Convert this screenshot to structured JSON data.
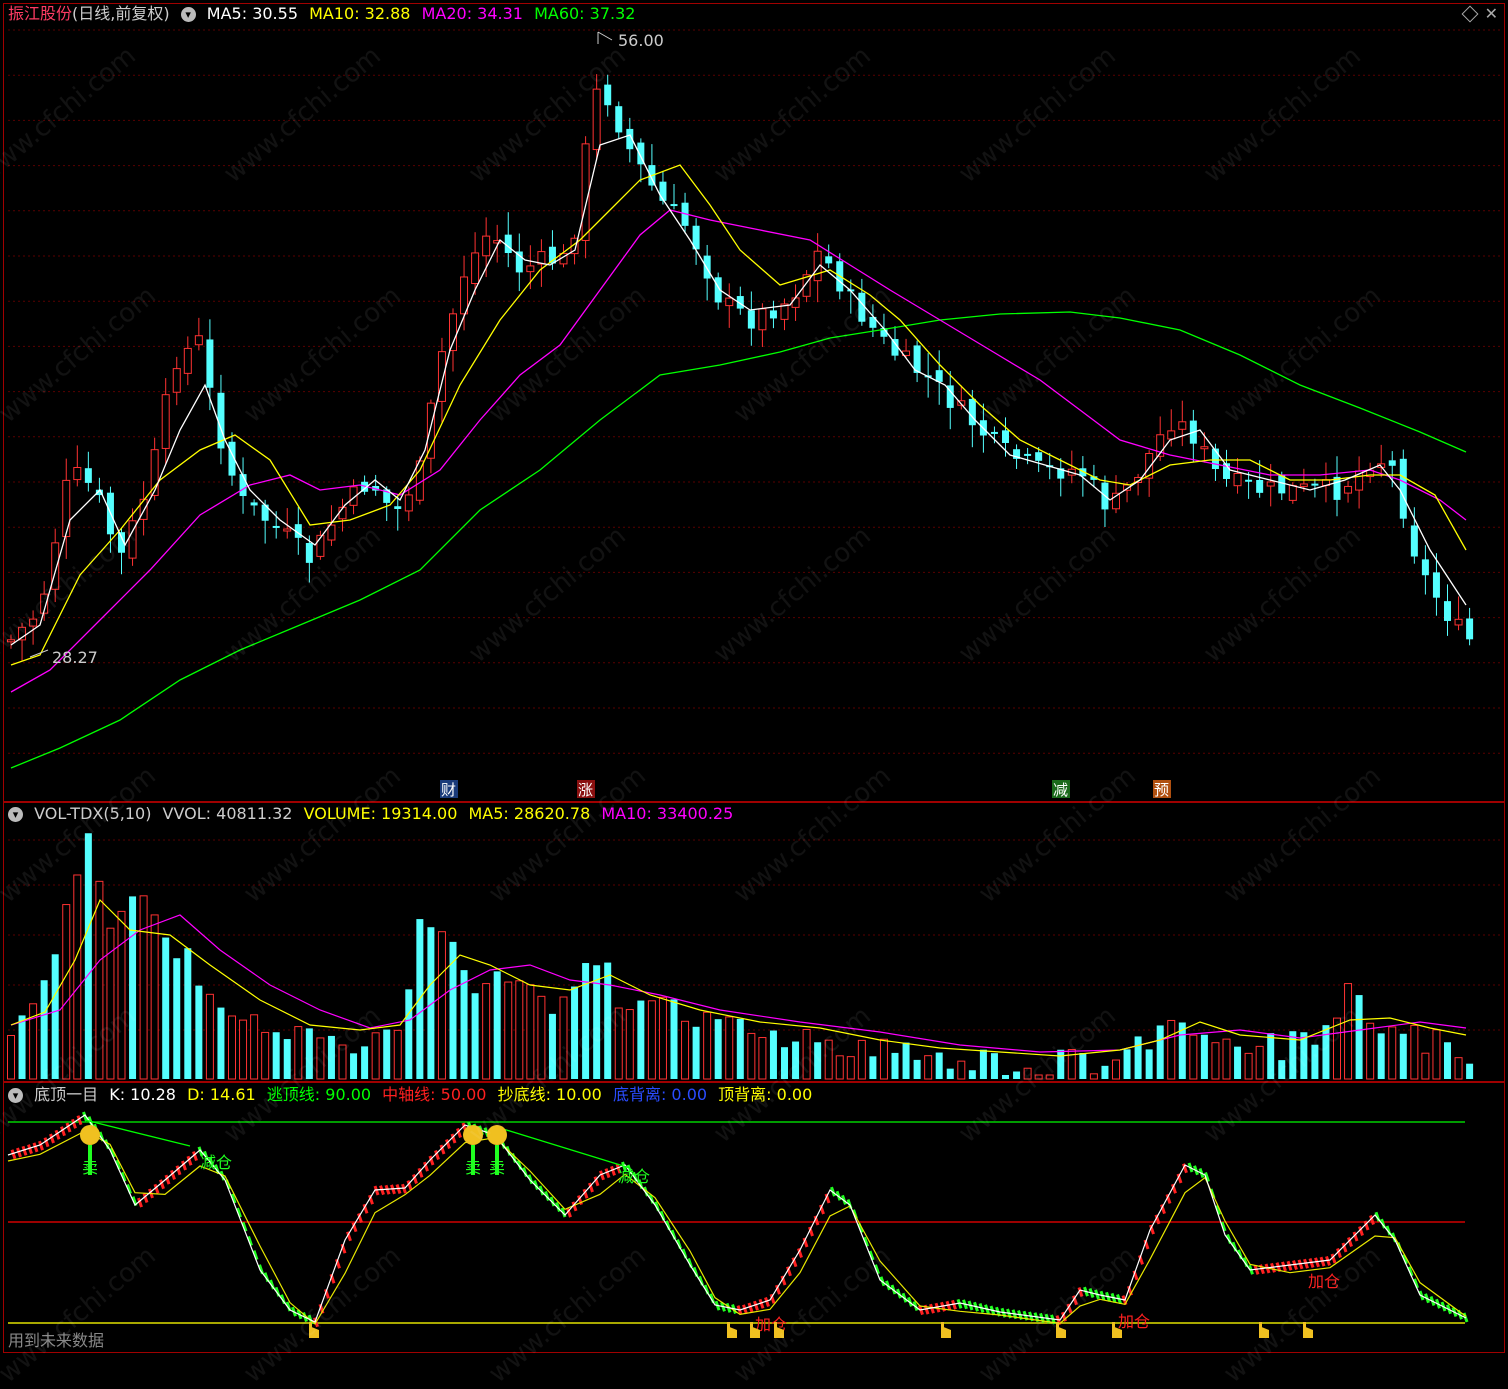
{
  "price_panel": {
    "stock_name": "振江股份",
    "period": "(日线,前复权)",
    "ma5": "MA5: 30.55",
    "ma10": "MA10: 32.88",
    "ma20": "MA20: 34.31",
    "ma60": "MA60: 37.32",
    "high_label": "56.00",
    "low_label": "28.27",
    "event_markers": [
      "财",
      "涨",
      "减",
      "预"
    ],
    "colors": {
      "ma5": "#ffffff",
      "ma10": "#ffff00",
      "ma20": "#ff00ff",
      "ma60": "#00ff00",
      "up": "#ff3232",
      "down": "#54ffff"
    }
  },
  "volume_panel": {
    "name": "VOL-TDX(5,10)",
    "vvol": "VVOL: 40811.32",
    "volume": "VOLUME: 19314.00",
    "ma5": "MA5: 28620.78",
    "ma10": "MA10: 33400.25"
  },
  "indicator_panel": {
    "name": "底顶一目",
    "k": "K: 10.28",
    "d": "D: 14.61",
    "escape_line": "逃顶线: 90.00",
    "middle_line": "中轴线: 50.00",
    "bottom_line": "抄底线: 10.00",
    "bottom_div": "底背离: 0.00",
    "top_div": "顶背离: 0.00",
    "signals": [
      "卖",
      "减仓",
      "卖",
      "卖",
      "减仓",
      "加仓",
      "加仓",
      "加仓"
    ]
  },
  "footer": "用到未来数据",
  "watermark": "www.cfchi.com"
}
